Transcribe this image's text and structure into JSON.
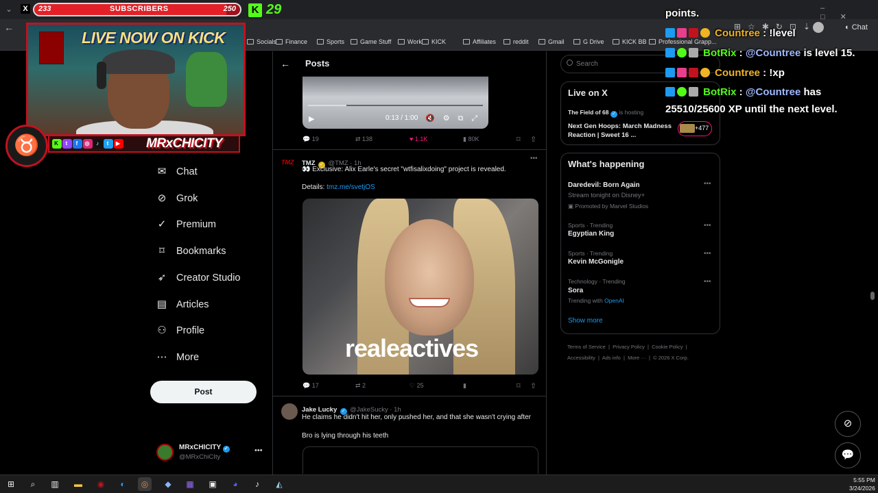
{
  "browser": {
    "tab_x": "X",
    "bookmarks": [
      "Socials",
      "Finance",
      "Sports",
      "Game Stuff",
      "Work",
      "KICK",
      "Affiliates",
      "reddit",
      "Gmail",
      "G Drive",
      "KICK BB",
      "Professional Grapp..."
    ],
    "chat_button": "Chat"
  },
  "overlay": {
    "subs_current": "233",
    "subs_label": "SUBSCRIBERS",
    "subs_goal": "250",
    "subs_progress_fraction": 0.932,
    "kick_logo": "K",
    "kick_count": "29",
    "live_banner": "LIVE NOW ON KICK",
    "social_handle": "MRxCHICITY"
  },
  "chat": {
    "header_fragment": "points.",
    "lines": [
      {
        "user": "Countree",
        "message": "!level",
        "user_color": "#f0b323"
      },
      {
        "user": "BotRix",
        "mention": "@Countree",
        "message": "is level 15.",
        "user_color": "#53fc18"
      },
      {
        "user": "Countree",
        "message": "!xp",
        "user_color": "#f0b323"
      },
      {
        "user": "BotRix",
        "mention": "@Countree",
        "message": "has",
        "user_color": "#53fc18"
      }
    ],
    "continuation": "25510/25600 XP until the next level."
  },
  "nav": {
    "items": [
      {
        "label": "Chat",
        "icon": "mail-icon"
      },
      {
        "label": "Grok",
        "icon": "grok-icon"
      },
      {
        "label": "Premium",
        "icon": "premium-icon"
      },
      {
        "label": "Bookmarks",
        "icon": "bookmark-icon"
      },
      {
        "label": "Creator Studio",
        "icon": "rocket-icon"
      },
      {
        "label": "Articles",
        "icon": "article-icon"
      },
      {
        "label": "Profile",
        "icon": "person-icon"
      },
      {
        "label": "More",
        "icon": "more-icon"
      }
    ],
    "post_button": "Post",
    "profile_name": "MRxCHICITY",
    "profile_handle": "@MRxChiCIty"
  },
  "feed": {
    "title": "Posts",
    "video": {
      "time": "0:13 / 1:00",
      "progress_fraction": 0.22
    },
    "post1_actions": {
      "replies": "19",
      "reposts": "138",
      "likes": "1.1K",
      "views": "80K"
    },
    "tmz": {
      "logo": "TMZ",
      "name": "TMZ",
      "handle": "@TMZ · 1h",
      "text": "👀 Exclusive: Alix Earle's secret \"wtfisalixdoing\" project is revealed.",
      "details_label": "Details:",
      "details_link": "tmz.me/svetjOS",
      "image_watermark": "realeactives",
      "replies": "17",
      "reposts": "2",
      "likes": "25"
    },
    "jake": {
      "name": "Jake Lucky",
      "handle": "@JakeSucky · 1h",
      "text1": "He claims he didn't hit her, only pushed her, and that she wasn't crying after",
      "text2": "Bro is lying through his teeth"
    }
  },
  "sidebar": {
    "search_placeholder": "Search",
    "live_title": "Live on X",
    "live_host_name": "The Field of 68",
    "live_host_suffix": "is hosting",
    "live_desc": "Next Gen Hoops: March Madness Reaction | Sweet 16 ...",
    "live_count": "+477",
    "happening_title": "What's happening",
    "trends": [
      {
        "category": "",
        "title": "Daredevil: Born Again",
        "sub": "Stream tonight on Disney+",
        "sub2": "Promoted by Marvel Studios"
      },
      {
        "category": "Sports · Trending",
        "title": "Egyptian King",
        "sub": "",
        "sub2": ""
      },
      {
        "category": "Sports · Trending",
        "title": "Kevin McGonigle",
        "sub": "",
        "sub2": ""
      },
      {
        "category": "Technology · Trending",
        "title": "Sora",
        "sub": "Trending with",
        "sub2": "OpenAI"
      }
    ],
    "show_more": "Show more",
    "footer_row1": [
      "Terms of Service",
      "Privacy Policy",
      "Cookie Policy"
    ],
    "footer_row2": [
      "Accessibility",
      "Ads info",
      "More ···",
      "© 2026 X Corp."
    ]
  },
  "taskbar": {
    "time": "5:55 PM",
    "date": "3/24/2026"
  }
}
